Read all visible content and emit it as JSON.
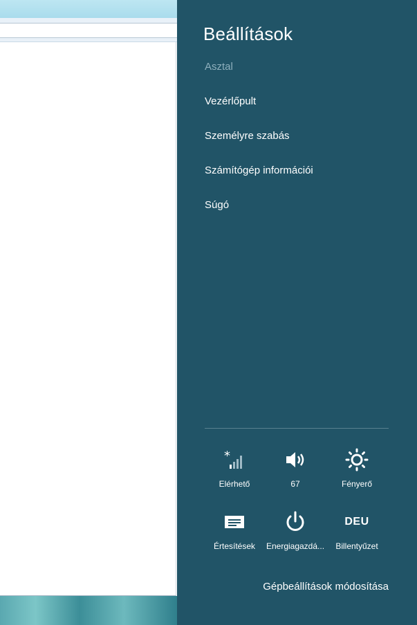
{
  "panel": {
    "title": "Beállítások",
    "subtitle": "Asztal",
    "menu": [
      {
        "label": "Vezérlőpult"
      },
      {
        "label": "Személyre szabás"
      },
      {
        "label": "Számítógép információi"
      },
      {
        "label": "Súgó"
      }
    ],
    "tiles": [
      {
        "label": "Elérhető",
        "icon": "network-signal-icon"
      },
      {
        "label": "67",
        "icon": "volume-icon"
      },
      {
        "label": "Fényerő",
        "icon": "brightness-icon"
      },
      {
        "label": "Értesítések",
        "icon": "notifications-icon"
      },
      {
        "label": "Energiagazdá...",
        "icon": "power-icon"
      },
      {
        "label": "Billentyűzet",
        "icon": "keyboard-icon",
        "icon_text": "DEU"
      }
    ],
    "change_settings": "Gépbeállítások módosítása",
    "colors": {
      "panel_bg": "#215467",
      "subtitle": "#8fb0bd"
    }
  }
}
